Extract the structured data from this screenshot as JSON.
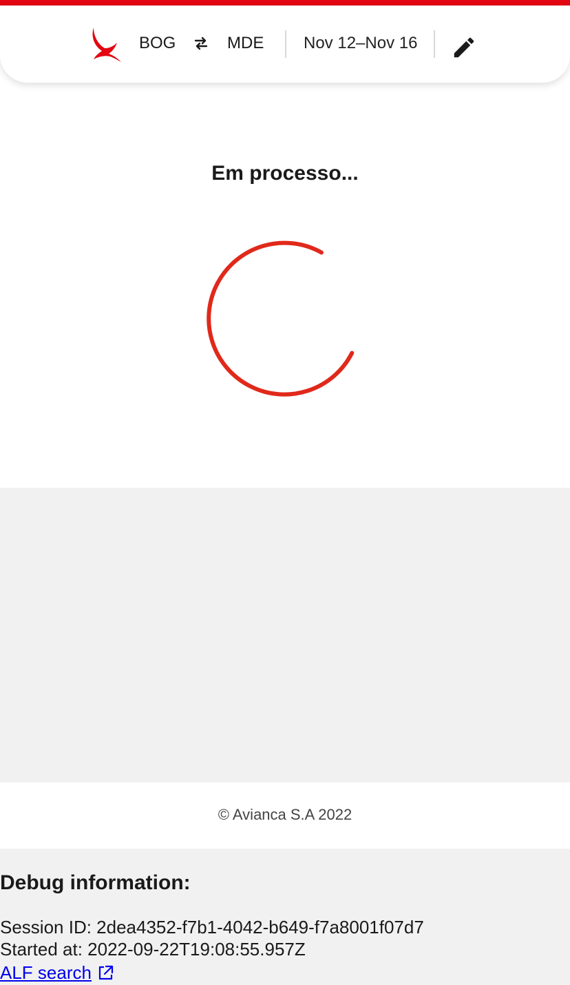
{
  "colors": {
    "brand_red": "#e30613",
    "spinner_red": "#e0291b",
    "link_blue": "#0000ee",
    "band_grey": "#f1f1f1"
  },
  "header": {
    "logo_icon": "avianca-bird-logo",
    "origin": "BOG",
    "swap_icon": "swap-arrows-icon",
    "destination": "MDE",
    "dates": "Nov 12–Nov 16",
    "edit_icon": "pencil-icon"
  },
  "main": {
    "status_title": "Em processo...",
    "spinner_icon": "loading-spinner"
  },
  "footer": {
    "copyright": "© Avianca S.A 2022"
  },
  "debug": {
    "title": "Debug information:",
    "session_line": "Session ID: 2dea4352-f7b1-4042-b649-f7a8001f07d7",
    "started_line": "Started at: 2022-09-22T19:08:55.957Z",
    "link_text": "ALF search",
    "link_icon": "external-link-icon"
  }
}
